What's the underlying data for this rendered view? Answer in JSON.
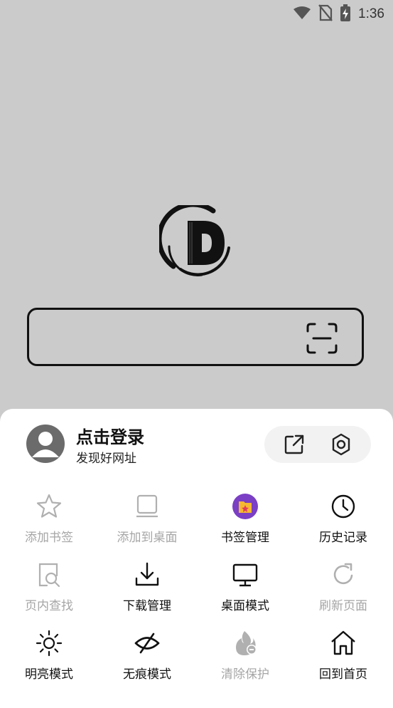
{
  "status_bar": {
    "time": "1:36",
    "icons": [
      "wifi-icon",
      "no-sim-icon",
      "battery-charging-icon"
    ]
  },
  "search": {
    "value": "",
    "scan_icon": "scan-icon"
  },
  "account": {
    "title": "点击登录",
    "subtitle": "发现好网址",
    "avatar_icon": "user-icon"
  },
  "quick_actions": {
    "share_icon": "share-icon",
    "settings_icon": "gear-icon"
  },
  "menu": {
    "items": [
      {
        "label": "添加书签",
        "icon": "star-icon",
        "enabled": false
      },
      {
        "label": "添加到桌面",
        "icon": "tablet-icon",
        "enabled": false
      },
      {
        "label": "书签管理",
        "icon": "bookmark-manager-icon",
        "enabled": true
      },
      {
        "label": "历史记录",
        "icon": "clock-icon",
        "enabled": true
      },
      {
        "label": "页内查找",
        "icon": "find-in-page-icon",
        "enabled": false
      },
      {
        "label": "下载管理",
        "icon": "download-icon",
        "enabled": true
      },
      {
        "label": "桌面模式",
        "icon": "monitor-icon",
        "enabled": true
      },
      {
        "label": "刷新页面",
        "icon": "refresh-icon",
        "enabled": false
      },
      {
        "label": "明亮模式",
        "icon": "sun-icon",
        "enabled": true
      },
      {
        "label": "无痕模式",
        "icon": "eye-off-icon",
        "enabled": true
      },
      {
        "label": "清除保护",
        "icon": "flame-clear-icon",
        "enabled": false
      },
      {
        "label": "回到首页",
        "icon": "home-icon",
        "enabled": true
      }
    ]
  },
  "colors": {
    "background": "#cbcbcb",
    "sheet": "#ffffff",
    "disabled_text": "#a6a6a6",
    "bookmark_badge": "#7a3fc4"
  }
}
